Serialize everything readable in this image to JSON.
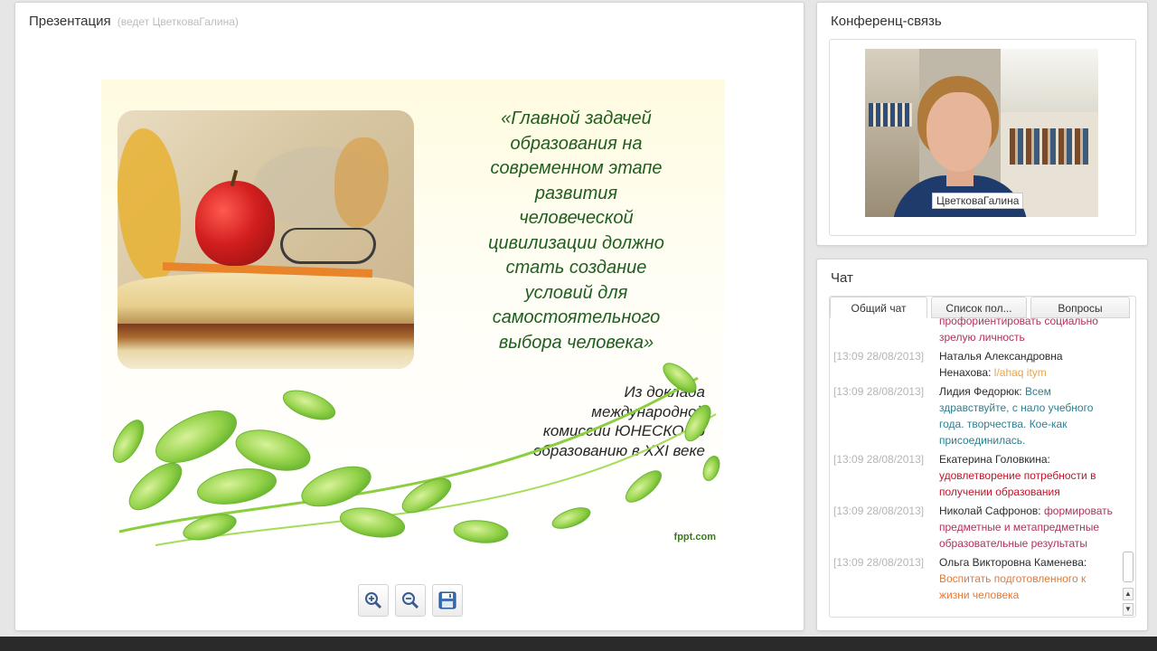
{
  "presentation": {
    "title": "Презентация",
    "host_line": "(ведет ЦветковаГалина)",
    "slide": {
      "quote_lines": [
        "«Главной задачей",
        "образования на",
        "современном этапе",
        "развития",
        "человеческой",
        "цивилизации должно",
        "стать создание",
        "условий для",
        "самостоятельного",
        "выбора человека»"
      ],
      "source_lines": [
        "Из доклада",
        "международной",
        "комиссии ЮНЕСКО  по",
        "образованию в XXI веке"
      ],
      "credit": "fppt.com"
    },
    "toolbar": {
      "zoom_in_icon": "zoom-in-icon",
      "zoom_out_icon": "zoom-out-icon",
      "save_icon": "floppy-disk-icon"
    }
  },
  "conference": {
    "title": "Конференц-связь",
    "speaker_name": "ЦветковаГалина"
  },
  "chat": {
    "title": "Чат",
    "tabs": [
      {
        "label": "Общий чат",
        "active": true
      },
      {
        "label": "Список пол...",
        "active": false
      },
      {
        "label": "Вопросы",
        "active": false
      }
    ],
    "partial_text": {
      "text1": "профориентировать социально",
      "text2": "зрелую личность",
      "color": "#b03060"
    },
    "messages": [
      {
        "time": "[13:09 28/08/2013]",
        "author": "Наталья Александровна Ненахова:",
        "text": "l/ahaq itym",
        "color": "#e8a44a"
      },
      {
        "time": "[13:09 28/08/2013]",
        "author": "Лидия Федорюк:",
        "text": "Всем здравствуйте, с нало учебного года. творчества. Кое-как присоединилась.",
        "color": "#2e7f8f"
      },
      {
        "time": "[13:09 28/08/2013]",
        "author": "Екатерина Головкина:",
        "text": "удовлетворение потребности в получении образования",
        "color": "#c0152a"
      },
      {
        "time": "[13:09 28/08/2013]",
        "author": "Николай Сафронов:",
        "text": "формировать предметные и метапредметные образовательные результаты",
        "color": "#b03060"
      },
      {
        "time": "[13:09 28/08/2013]",
        "author": "Ольга Викторовна Каменева:",
        "text": "Воспитать подготовленного к жизни человека",
        "color": "#e07a3a"
      }
    ],
    "scroll_up_icon": "arrow-up-icon",
    "scroll_down_icon": "arrow-down-icon"
  }
}
